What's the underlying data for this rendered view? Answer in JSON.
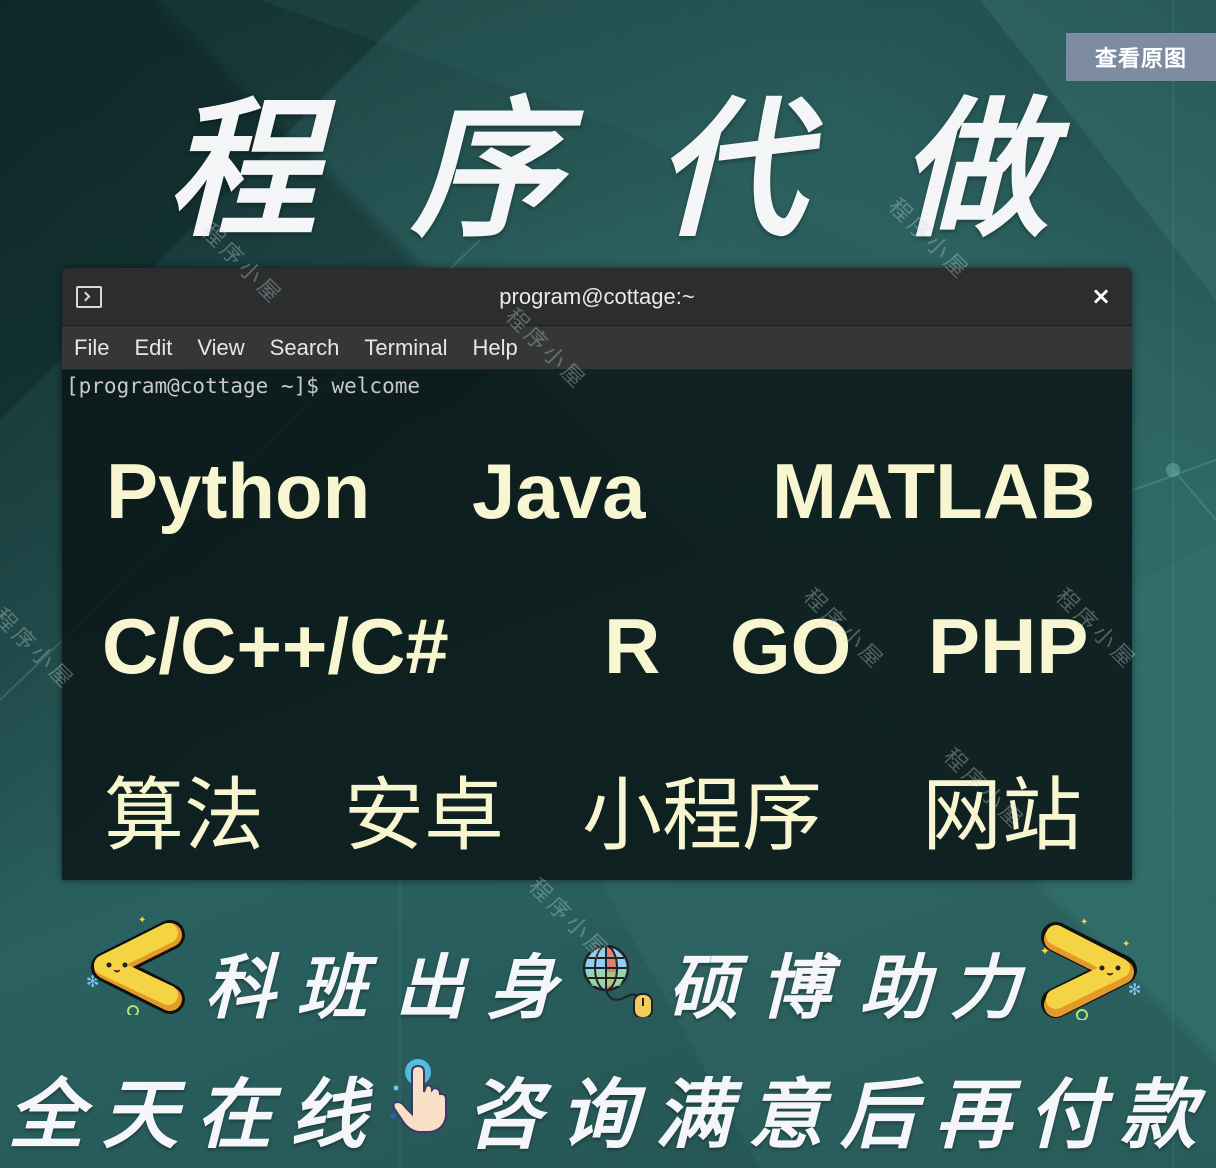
{
  "view_original_button": "查看原图",
  "title_chars": [
    "程",
    "序",
    "代",
    "做"
  ],
  "terminal": {
    "window_title": "program@cottage:~",
    "close_label": "×",
    "menu": [
      "File",
      "Edit",
      "View",
      "Search",
      "Terminal",
      "Help"
    ],
    "prompt": "[program@cottage ~]$ welcome",
    "rows": [
      [
        "Python",
        "Java",
        "MATLAB"
      ],
      [
        "C/C++/C#",
        "R",
        "GO",
        "PHP"
      ],
      [
        "算法",
        "安卓",
        "小程序",
        "网站"
      ]
    ]
  },
  "slogan_line1": {
    "left_chars": [
      "科",
      "班",
      "出",
      "身"
    ],
    "right_chars": [
      "硕",
      "博",
      "助",
      "力"
    ],
    "left_icon": "chevron-left-mascot-icon",
    "middle_icon": "globe-mouse-icon",
    "right_icon": "chevron-right-mascot-icon"
  },
  "slogan_line2": {
    "left_chars": [
      "全",
      "天",
      "在",
      "线"
    ],
    "right_chars": [
      "咨",
      "询",
      "满",
      "意",
      "后",
      "再",
      "付",
      "款"
    ],
    "middle_icon": "pointing-hand-icon"
  },
  "watermark_text": "程序小屋",
  "colors": {
    "background": "#234f4f",
    "terminal_text": "#f8f6d0",
    "button_bg": "#7d8ca0",
    "mascot_yellow": "#f5d443"
  }
}
